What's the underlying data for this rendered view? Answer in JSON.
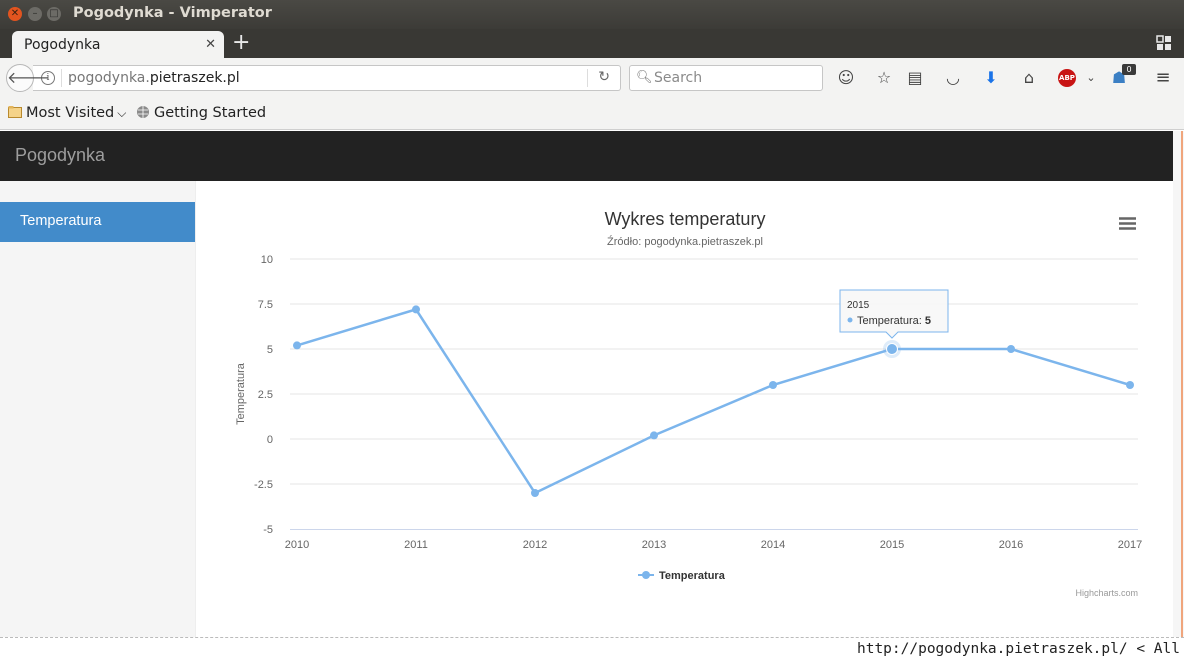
{
  "window": {
    "title": "Pogodynka - Vimperator"
  },
  "tabs": [
    {
      "label": "Pogodynka"
    }
  ],
  "nav": {
    "url_prefix": "pogodynka.",
    "url_domain": "pietraszek.pl",
    "search_placeholder": "Search",
    "notification_count": "0"
  },
  "bookmarks": [
    {
      "label": "Most Visited"
    },
    {
      "label": "Getting Started"
    }
  ],
  "app": {
    "brand": "Pogodynka",
    "sidebar": [
      {
        "label": "Temperatura"
      }
    ]
  },
  "chart_data": {
    "type": "line",
    "title": "Wykres temperatury",
    "subtitle": "Źródło: pogodynka.pietraszek.pl",
    "ylabel": "Temperatura",
    "xlabel": "",
    "ylim": [
      -5,
      10
    ],
    "yticks": [
      "10",
      "7.5",
      "5",
      "2.5",
      "0",
      "-2.5",
      "-5"
    ],
    "categories": [
      "2010",
      "2011",
      "2012",
      "2013",
      "2014",
      "2015",
      "2016",
      "2017"
    ],
    "series": [
      {
        "name": "Temperatura",
        "values": [
          5.2,
          7.2,
          -3,
          0.2,
          3,
          5,
          5,
          3
        ],
        "color": "#7cb5ec"
      }
    ],
    "legend": "bottom-center",
    "grid": true,
    "tooltip": {
      "category": "2015",
      "label": "Temperatura: ",
      "value": "5"
    },
    "credits": "Highcharts.com"
  },
  "status": {
    "text": "http://pogodynka.pietraszek.pl/ < All"
  }
}
